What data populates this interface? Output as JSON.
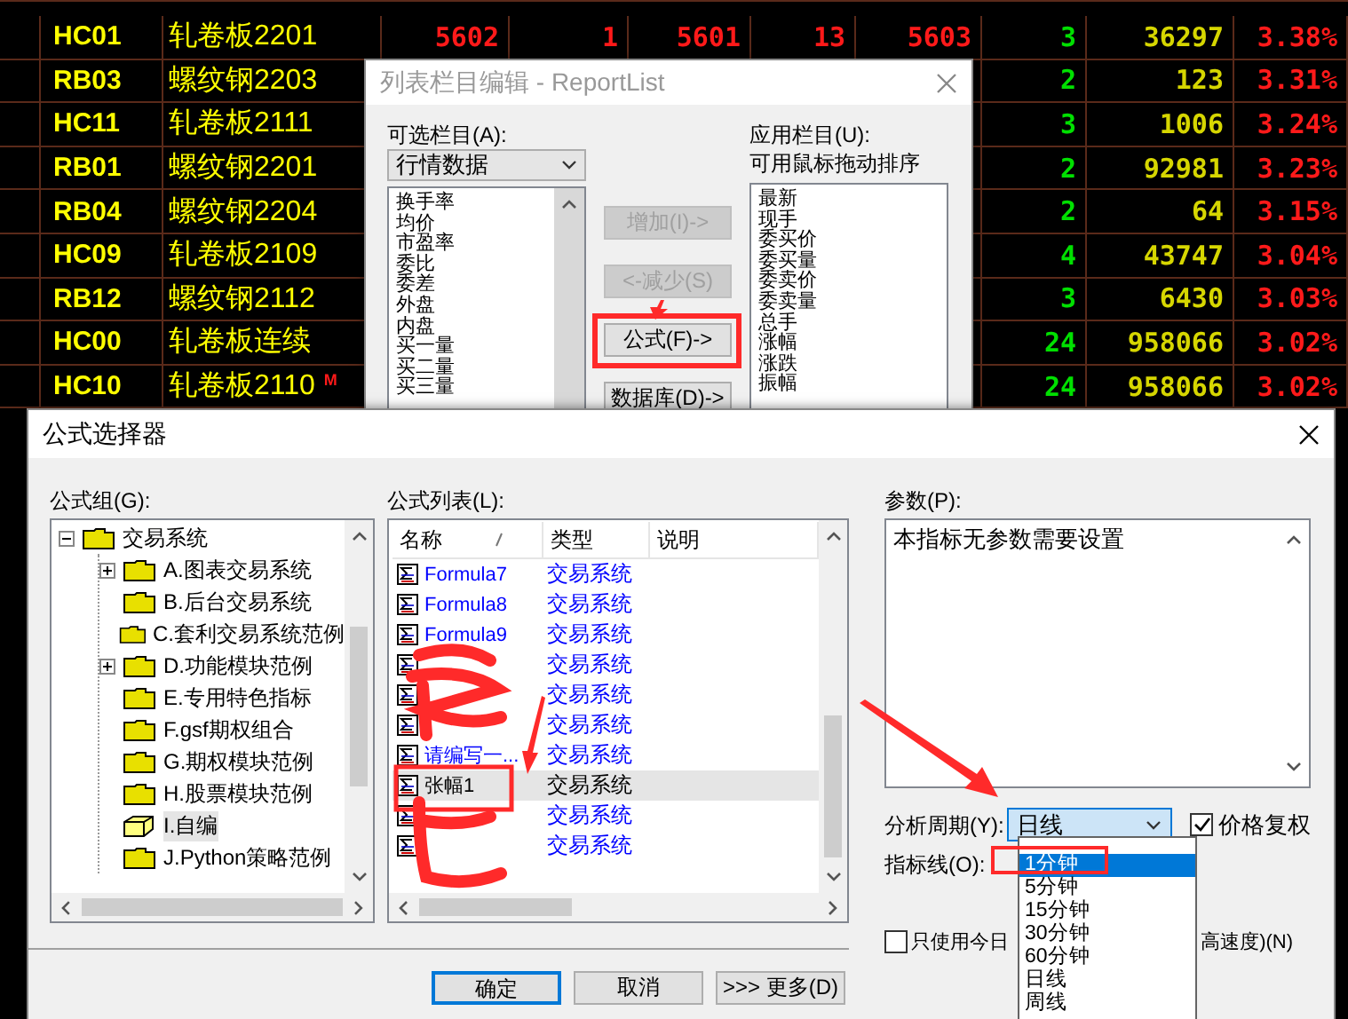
{
  "quote_table": {
    "rows": [
      {
        "code": "HC01",
        "name": "轧卷板2201",
        "price": "5602",
        "qty": "1",
        "bid": "5601",
        "bid_qty": "13",
        "ask": "5603",
        "count": "3",
        "volume": "36297",
        "change": "3.38%"
      },
      {
        "code": "RB03",
        "name": "螺纹钢2203",
        "count": "2",
        "volume": "123",
        "change": "3.31%"
      },
      {
        "code": "HC11",
        "name": "轧卷板2111",
        "count": "3",
        "volume": "1006",
        "change": "3.24%"
      },
      {
        "code": "RB01",
        "name": "螺纹钢2201",
        "count": "2",
        "volume": "92981",
        "change": "3.23%"
      },
      {
        "code": "RB04",
        "name": "螺纹钢2204",
        "count": "2",
        "volume": "64",
        "change": "3.15%"
      },
      {
        "code": "HC09",
        "name": "轧卷板2109",
        "count": "4",
        "volume": "43747",
        "change": "3.04%"
      },
      {
        "code": "RB12",
        "name": "螺纹钢2112",
        "count": "3",
        "volume": "6430",
        "change": "3.03%"
      },
      {
        "code": "HC00",
        "name": "轧卷板连续",
        "count": "24",
        "volume": "958066",
        "change": "3.02%"
      },
      {
        "code": "HC10",
        "name": "轧卷板2110",
        "flag": "M",
        "count": "24",
        "volume": "958066",
        "change": "3.02%"
      }
    ]
  },
  "report_list_dialog": {
    "title": "列表栏目编辑 - ReportList",
    "active": false,
    "available_label": "可选栏目(A):",
    "category": "行情数据",
    "available_items": [
      "换手率",
      "均价",
      "市盈率",
      "委比",
      "委差",
      "外盘",
      "内盘",
      "买一量",
      "买二量",
      "买三量"
    ],
    "buttons": [
      {
        "label": "增加(I)->",
        "disabled": true
      },
      {
        "label": "<-减少(S)",
        "disabled": true
      },
      {
        "label": "公式(F)->",
        "disabled": false
      },
      {
        "label": "数据库(D)->",
        "disabled": false
      }
    ],
    "applied_label": "应用栏目(U):",
    "applied_hint": "可用鼠标拖动排序",
    "applied_items": [
      "最新",
      "现手",
      "委买价",
      "委买量",
      "委卖价",
      "委卖量",
      "总手",
      "涨幅",
      "涨跌",
      "振幅"
    ]
  },
  "formula_dialog": {
    "title": "公式选择器",
    "group_label": "公式组(G):",
    "groups": [
      {
        "label": "交易系统",
        "has_children": true,
        "expanded": true,
        "selected": false,
        "children": [
          {
            "label": "A.图表交易系统",
            "has_children": true,
            "expanded": false,
            "selected": false
          },
          {
            "label": "B.后台交易系统",
            "has_children": false,
            "selected": false
          },
          {
            "label": "C.套利交易系统范例",
            "has_children": false,
            "selected": false
          },
          {
            "label": "D.功能模块范例",
            "has_children": true,
            "expanded": false,
            "selected": false
          },
          {
            "label": "E.专用特色指标",
            "has_children": false,
            "selected": false
          },
          {
            "label": "F.gsf期权组合",
            "has_children": false,
            "selected": false
          },
          {
            "label": "G.期权模块范例",
            "has_children": false,
            "selected": false
          },
          {
            "label": "H.股票模块范例",
            "has_children": false,
            "selected": false
          },
          {
            "label": "I.自编",
            "has_children": false,
            "selected": true
          },
          {
            "label": "J.Python策略范例",
            "has_children": false,
            "selected": false
          }
        ]
      }
    ],
    "list_label": "公式列表(L):",
    "columns": [
      "名称",
      "类型",
      "说明"
    ],
    "formulas": [
      {
        "name": "Formula7",
        "type": "交易系统",
        "selected": false
      },
      {
        "name": "Formula8",
        "type": "交易系统",
        "selected": false
      },
      {
        "name": "Formula9",
        "type": "交易系统",
        "selected": false
      },
      {
        "type": "交易系统",
        "selected": false
      },
      {
        "type": "交易系统",
        "selected": false
      },
      {
        "type": "交易系统",
        "selected": false
      },
      {
        "name": "请编写一...",
        "type": "交易系统",
        "selected": false
      },
      {
        "name": "张幅1",
        "type": "交易系统",
        "selected": true
      },
      {
        "type": "交易系统",
        "selected": false
      },
      {
        "type": "交易系统",
        "selected": false
      }
    ],
    "param_label": "参数(P):",
    "param_text": "本指标无参数需要设置",
    "period_label": "分析周期(Y):",
    "period_value": "日线",
    "period_options": [
      {
        "label": "1分钟",
        "selected": true
      },
      {
        "label": "5分钟",
        "selected": false
      },
      {
        "label": "15分钟",
        "selected": false
      },
      {
        "label": "30分钟",
        "selected": false
      },
      {
        "label": "60分钟",
        "selected": false
      },
      {
        "label": "日线",
        "selected": false
      },
      {
        "label": "周线",
        "selected": false
      }
    ],
    "adjust_price": {
      "label": "价格复权",
      "checked": true
    },
    "indicator_label": "指标线(O):",
    "today_only": {
      "label_start": "只使用今日",
      "label_end": "高速度)(N)",
      "checked": false
    },
    "buttons": [
      {
        "label": "确定",
        "default": true
      },
      {
        "label": "取消",
        "default": false
      },
      {
        "label": ">>> 更多(D)",
        "default": false
      }
    ]
  }
}
